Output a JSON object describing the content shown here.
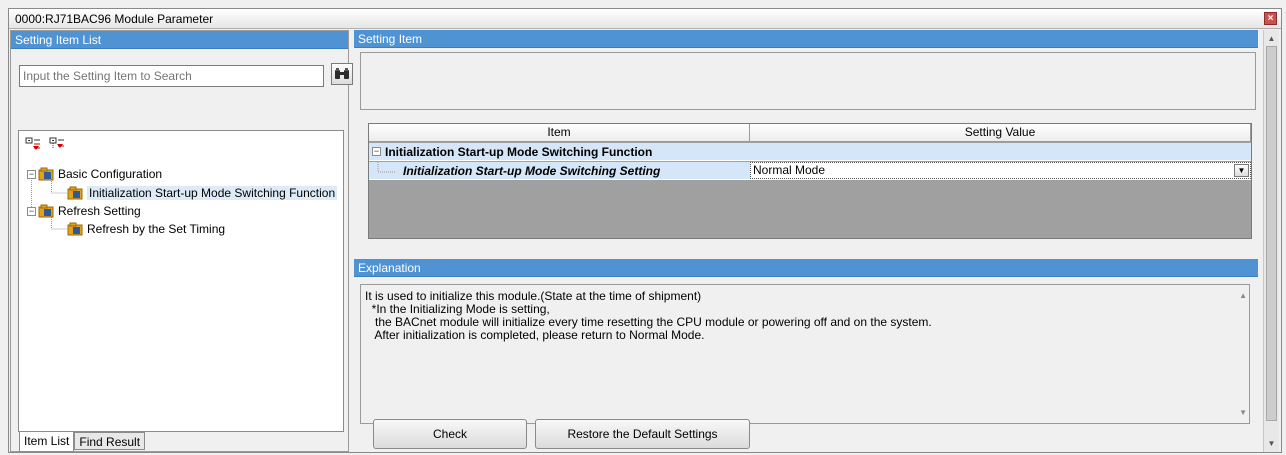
{
  "window": {
    "title": "0000:RJ71BAC96 Module Parameter"
  },
  "left_panel": {
    "header": "Setting Item List",
    "search_placeholder": "Input the Setting Item to Search",
    "tree": [
      {
        "label": "Basic Configuration"
      },
      {
        "label": "Initialization Start-up Mode Switching Function"
      },
      {
        "label": "Refresh Setting"
      },
      {
        "label": "Refresh by the Set Timing"
      }
    ],
    "tabs": [
      "Item List",
      "Find Result"
    ]
  },
  "setting_panel": {
    "header": "Setting Item",
    "grid": {
      "columns": [
        "Item",
        "Setting Value"
      ],
      "rows": [
        {
          "item": "Initialization Start-up Mode Switching Function",
          "value": ""
        },
        {
          "item": "Initialization Start-up Mode Switching Setting",
          "value": "Normal Mode"
        }
      ]
    }
  },
  "explanation": {
    "header": "Explanation",
    "lines": [
      "It is used to initialize this module.(State at the time of shipment)",
      "  *In the Initializing Mode is setting,",
      "   the BACnet module will initialize every time resetting the CPU module or powering off and on the system.",
      "   After initialization is completed, please return to Normal Mode."
    ]
  },
  "buttons": {
    "check": "Check",
    "restore": "Restore the Default Settings"
  },
  "icons": {
    "search": "binoculars-icon",
    "folder": "folder-book-icon",
    "expand_all": "expand-all-icon",
    "collapse_all": "collapse-all-icon"
  }
}
